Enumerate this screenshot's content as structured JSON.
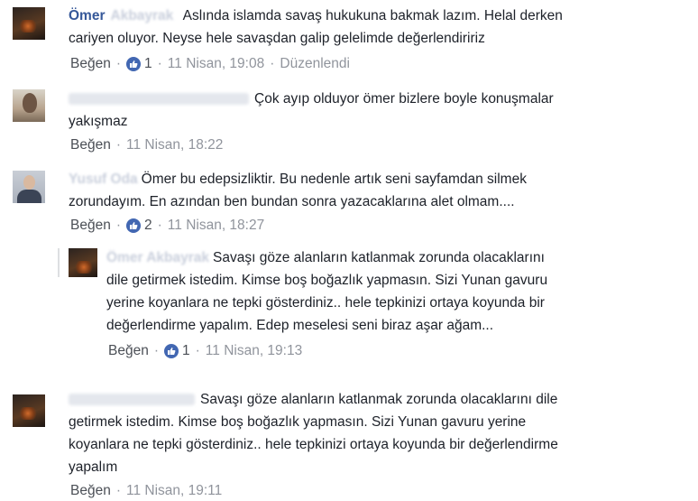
{
  "comments": [
    {
      "author": "Ömer",
      "author_faded": "Akbayrak",
      "text_line1": "Aslında islamda savaş hukukuna bakmak lazım. Helal derken",
      "text_line2": "cariyen oluyor. Neyse hele savaşdan galip gelelimde değerlendiririz",
      "like_label": "Beğen",
      "reaction_count": "1",
      "timestamp": "11 Nisan, 19:08",
      "edited": "Düzenlendi"
    },
    {
      "text_line1": "Çok ayıp olduyor ömer bizlere boyle konuşmalar",
      "text_line2": "yakışmaz",
      "like_label": "Beğen",
      "timestamp": "11 Nisan, 18:22"
    },
    {
      "author_faded": "Yusuf Oda",
      "text_line1": "Ömer bu edepsizliktir. Bu nedenle artık seni sayfamdan silmek",
      "text_line2": "zorundayım. En azından ben bundan sonra yazacaklarına alet olmam....",
      "like_label": "Beğen",
      "reaction_count": "2",
      "timestamp": "11 Nisan, 18:27"
    },
    {
      "author_faded": "Ömer Akbayrak",
      "text_line1": "Savaşı göze alanların katlanmak zorunda olacaklarını",
      "text_line2": "dile getirmek istedim. Kimse boş boğazlık yapmasın. Sizi Yunan gavuru",
      "text_line3": "yerine koyanlara ne tepki gösterdiniz.. hele tepkinizi ortaya koyunda bir",
      "text_line4": "değerlendirme yapalım. Edep meselesi seni biraz aşar ağam...",
      "like_label": "Beğen",
      "reaction_count": "1",
      "timestamp": "11 Nisan, 19:13"
    },
    {
      "text_line1": "Savaşı göze alanların katlanmak zorunda olacaklarını dile",
      "text_line2": "getirmek istedim. Kimse boş boğazlık yapmasın. Sizi Yunan gavuru yerine",
      "text_line3": "koyanlara ne tepki gösterdiniz.. hele tepkinizi ortaya koyunda bir değerlendirme",
      "text_line4": "yapalım",
      "like_label": "Beğen",
      "timestamp": "11 Nisan, 19:11"
    }
  ],
  "separator": "·",
  "colors": {
    "link": "#365899",
    "meta": "#90949c",
    "like_badge": "#4267b2"
  },
  "icons": {
    "reaction": "thumbs-up-icon"
  }
}
